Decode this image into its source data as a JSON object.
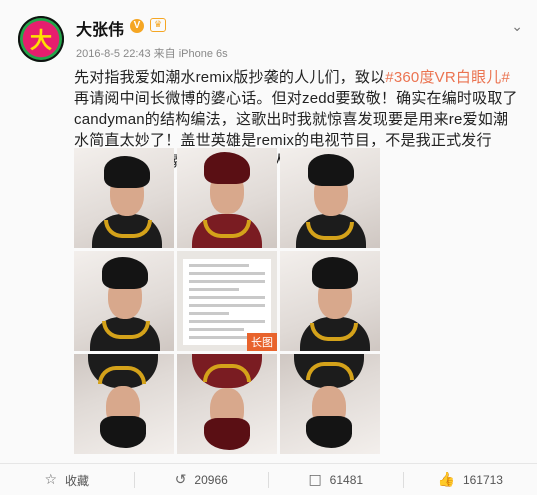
{
  "post": {
    "avatar_text": "大",
    "author": "大张伟",
    "v_badge": "V",
    "crown_badge": "♛",
    "time": "2016-8-5 22:43 来自 iPhone 6s",
    "menu_icon": "chevron-down-icon",
    "text_before_tag": "先对指我爱如潮水remix版抄袭的人儿们，致以",
    "tag": "#360度VR白眼儿#",
    "text_after_tag": "再请阅中间长微博的婆心话。但对zedd要致敬！确实在编时吸取了candyman的结构编法，这歌出时我就惊喜发现要是用来re爱如潮水简直太妙了！盖世英雄是remix的电视节目，不是我正式发行歌，多天赐良缘啊～怎么还有人不开心呢？",
    "long_image_badge": "长图"
  },
  "footer": {
    "collect_label": "收藏",
    "repost_count": "20966",
    "comment_count": "61481",
    "like_count": "161713"
  },
  "colors": {
    "tag": "#eb7350",
    "badge": "#f5a623",
    "long_badge": "#e8632c"
  }
}
